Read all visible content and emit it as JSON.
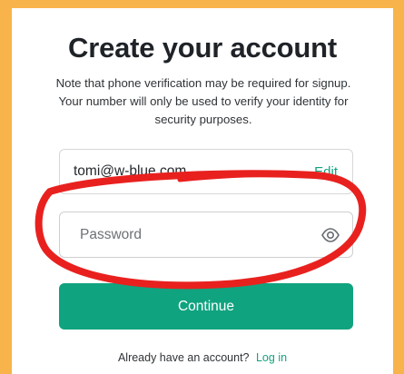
{
  "page": {
    "title": "Create your account",
    "note": "Note that phone verification may be required for signup. Your number will only be used to verify your identity for security purposes."
  },
  "email_field": {
    "value": "tomi@w-blue.com",
    "edit_label": "Edit"
  },
  "password_field": {
    "placeholder": "Password",
    "icon": "eye-icon"
  },
  "continue_button": {
    "label": "Continue"
  },
  "login_prompt": {
    "text": "Already have an account?",
    "link_label": "Log in"
  },
  "colors": {
    "background": "#f8b44a",
    "accent": "#10a37f",
    "annotation": "#e8211f"
  }
}
